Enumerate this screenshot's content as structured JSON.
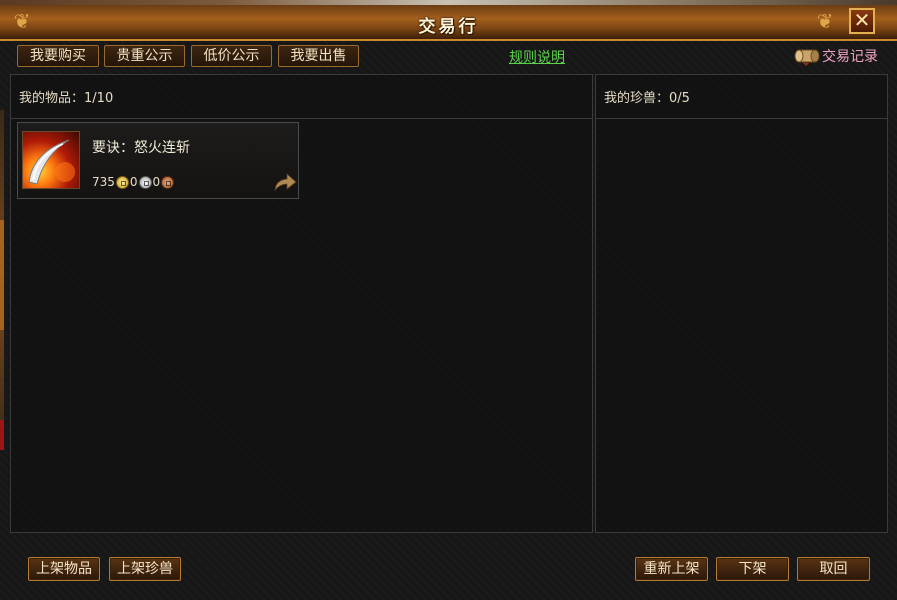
{
  "window": {
    "title": "交易行"
  },
  "tabs": [
    {
      "label": "我要购买"
    },
    {
      "label": "贵重公示"
    },
    {
      "label": "低价公示"
    },
    {
      "label": "我要出售"
    }
  ],
  "rules_link": "规则说明",
  "trade_record": {
    "label": "交易记录",
    "icon": "scroll-icon"
  },
  "left_panel": {
    "label": "我的物品：",
    "count": "1/10",
    "items": [
      {
        "name": "要诀：怒火连斩",
        "gold": "735",
        "silver": "0",
        "copper": "0",
        "icon": "sword-fire-icon"
      }
    ]
  },
  "right_panel": {
    "label": "我的珍兽：",
    "count": "0/5"
  },
  "buttons": {
    "list_item": "上架物品",
    "list_pet": "上架珍兽",
    "relist": "重新上架",
    "delist": "下架",
    "withdraw": "取回"
  },
  "colors": {
    "accent": "#c88a2c",
    "link": "#5bd24a",
    "record": "#f0a4c4",
    "text": "#e6dcc6"
  }
}
